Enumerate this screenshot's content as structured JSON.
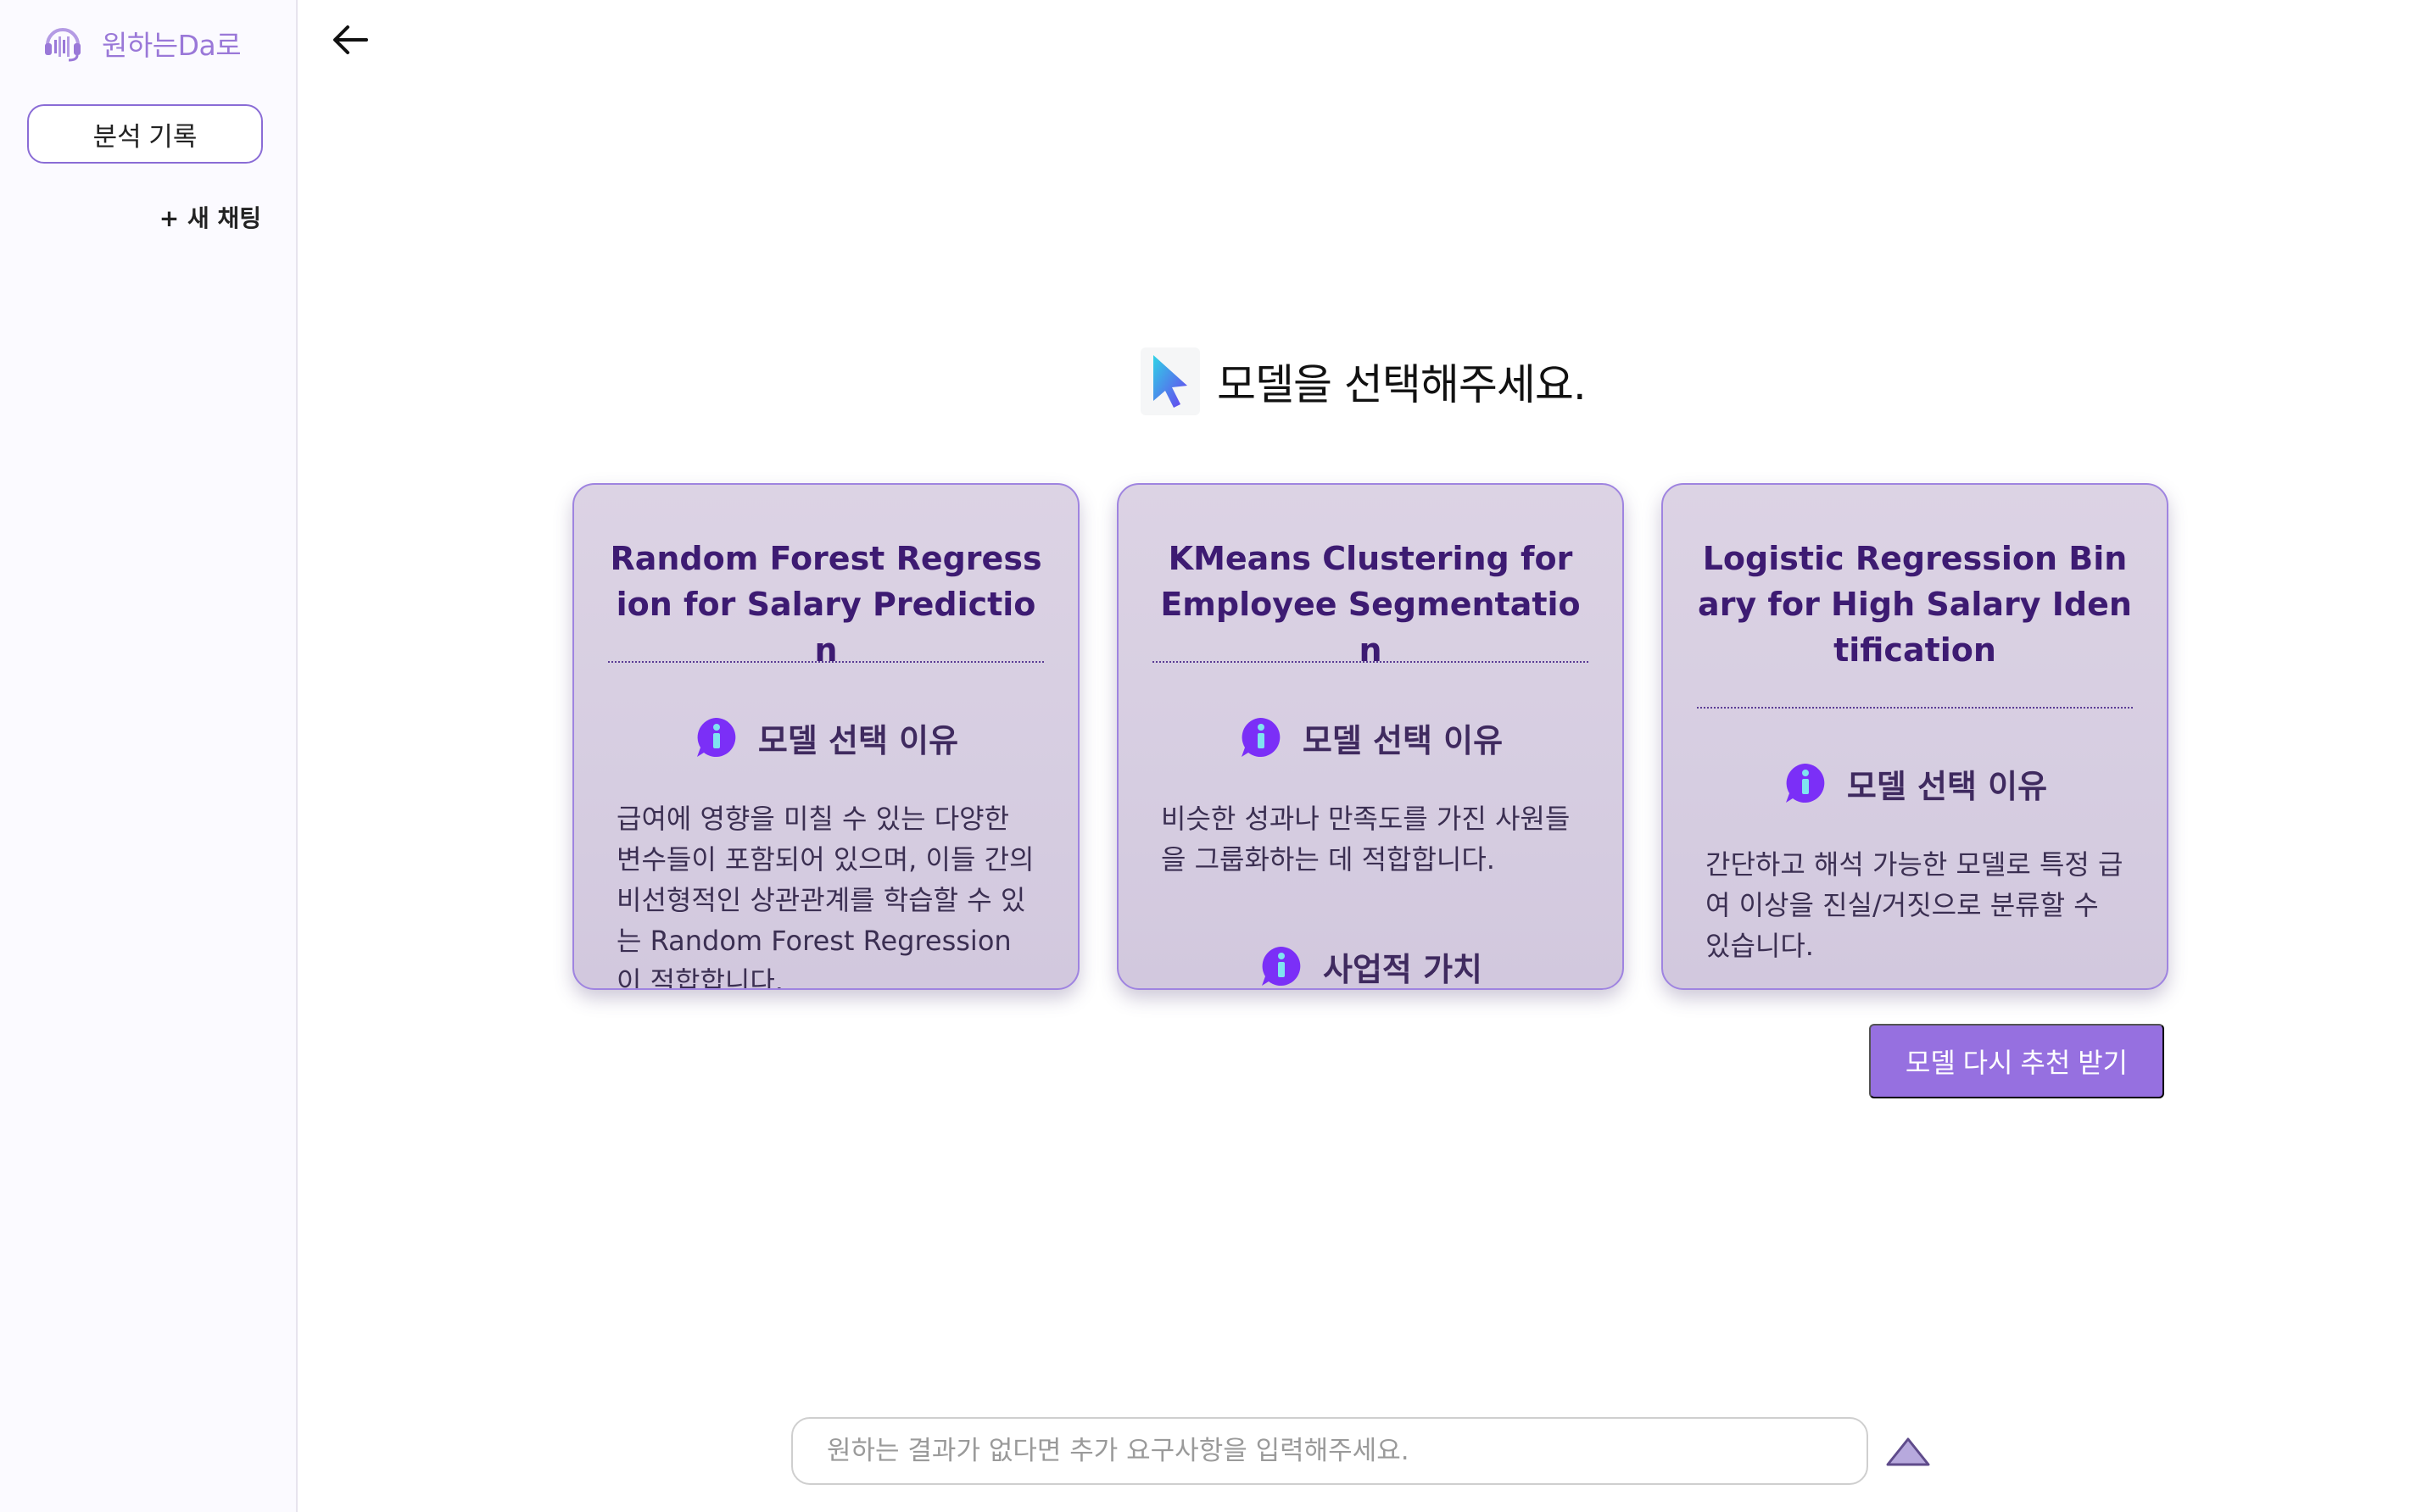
{
  "sidebar": {
    "brand_name": "원하는Da로",
    "history_button": "분석 기록",
    "new_chat": "+ 새 채팅"
  },
  "main": {
    "heading": "모델을 선택해주세요.",
    "cards": [
      {
        "title": "Random Forest Regression for Salary Prediction",
        "sections": [
          {
            "label": "모델 선택 이유",
            "body": "급여에 영향을 미칠 수 있는 다양한 변수들이 포함되어 있으며, 이들 간의 비선형적인 상관관계를 학습할 수 있는 Random Forest Regression이 적합합니다."
          }
        ]
      },
      {
        "title": "KMeans Clustering for Employee Segmentation",
        "sections": [
          {
            "label": "모델 선택 이유",
            "body": "비슷한 성과나 만족도를 가진 사원들을 그룹화하는 데 적합합니다."
          },
          {
            "label": "사업적 가치",
            "body": ""
          }
        ]
      },
      {
        "title": "Logistic Regression Binary for High Salary Identification",
        "sections": [
          {
            "label": "모델 선택 이유",
            "body": "간단하고 해석 가능한 모델로 특정 급여 이상을 진실/거짓으로 분류할 수 있습니다."
          }
        ]
      }
    ],
    "rerecommend_button": "모델 다시 추천 받기"
  },
  "chat": {
    "placeholder": "원하는 결과가 없다면 추가 요구사항을 입력해주세요.",
    "value": ""
  },
  "colors": {
    "accent": "#9670e0",
    "card_border": "#9f84e0",
    "card_title": "#3d1b72",
    "info_icon": "#7b2ff7"
  },
  "icons": {
    "brand": "headset-logo-icon",
    "back": "arrow-left-icon",
    "heading": "cursor-pointer-icon",
    "section": "info-icon",
    "send": "send-triangle-icon"
  }
}
